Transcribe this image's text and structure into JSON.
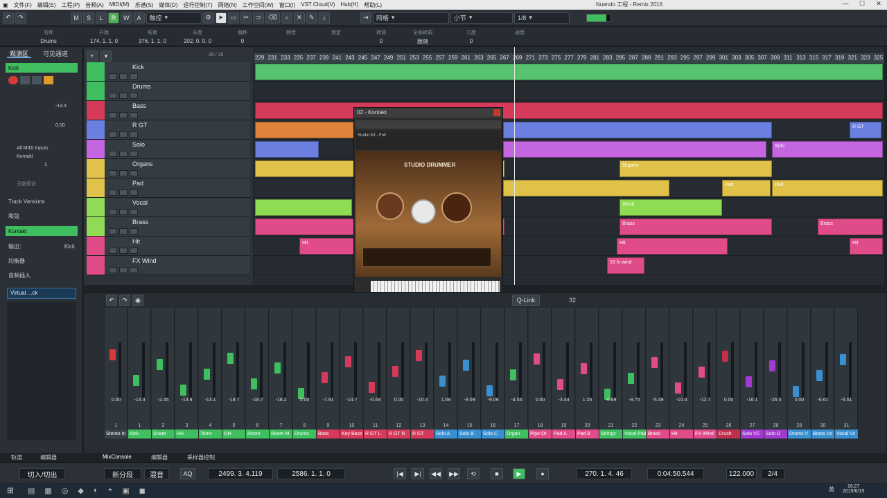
{
  "menu": [
    "文件(F)",
    "编辑(E)",
    "工程(P)",
    "音频(A)",
    "MIDI(M)",
    "乐谱(S)",
    "媒体(D)",
    "运行控制(T)",
    "网络(N)",
    "工作空间(W)",
    "窗口(I)",
    "VST Cloud(V)",
    "Hub(H)",
    "帮助(L)"
  ],
  "window_title": "Nuendo 工程 - Remix 2016",
  "toolbar": {
    "msl": [
      "M",
      "S",
      "L"
    ],
    "rwa": [
      "R",
      "W",
      "A"
    ],
    "mode": "触控",
    "grid": "网格",
    "snap_unit": "小节",
    "quantize": "1/8"
  },
  "infoline": {
    "headers": [
      "名称",
      "开始",
      "结束",
      "长度",
      "偏移",
      "静音",
      "锁定",
      "转调",
      "全局转调",
      "力度",
      "通音"
    ],
    "values": [
      "Drums",
      "174. 1. 1. 0",
      "376. 1. 1. 0",
      "202. 0. 0. 0",
      "0",
      "",
      "",
      "0",
      "跟随",
      "0",
      ""
    ]
  },
  "inspector": {
    "tabs": [
      "观测区",
      "可见通道"
    ],
    "track": "Kick",
    "volume": "-14.3",
    "pan": "0.00",
    "input": "All MIDI Inputs",
    "output": "Kontakt",
    "channel": "1",
    "nofx": "无数预设",
    "sections": [
      "Track Versions",
      "和弦",
      "Kontakt",
      "输出：",
      "均衡器",
      "音频插入"
    ],
    "output_value": "Kick",
    "insert": "Virtual ...ck"
  },
  "tracklist": {
    "count": "35 / 35",
    "tracks": [
      {
        "name": "Kick",
        "color": "#3fbf5f"
      },
      {
        "name": "Drums",
        "color": "#3fbf5f"
      },
      {
        "name": "Bass",
        "color": "#d63a5a"
      },
      {
        "name": "R GT",
        "color": "#6a7fe0"
      },
      {
        "name": "Solo",
        "color": "#c466e0"
      },
      {
        "name": "Organs",
        "color": "#e0c24a"
      },
      {
        "name": "Pad",
        "color": "#e0c24a"
      },
      {
        "name": "Vocal",
        "color": "#8fdc54"
      },
      {
        "name": "Brass",
        "color": "#8fdc54"
      },
      {
        "name": "Hit",
        "color": "#e04c8a"
      },
      {
        "name": "FX Wind",
        "color": "#e04c8a"
      }
    ]
  },
  "ruler": [
    "229",
    "231",
    "233",
    "235",
    "237",
    "239",
    "241",
    "243",
    "245",
    "247",
    "249",
    "251",
    "253",
    "255",
    "257",
    "259",
    "261",
    "263",
    "265",
    "267",
    "269",
    "271",
    "273",
    "275",
    "277",
    "279",
    "281",
    "283",
    "285",
    "287",
    "289",
    "291",
    "293",
    "295",
    "297",
    "299",
    "301",
    "303",
    "305",
    "307",
    "309",
    "311",
    "313",
    "315",
    "317",
    "319",
    "321",
    "323",
    "325"
  ],
  "clips": {
    "organs": "Organs",
    "vocal": "Vocal",
    "brass": "Brass",
    "hit": "Hit",
    "pad": "Pad",
    "solo": "Solo",
    "rgt": "R GT",
    "wind": "15 fx wind"
  },
  "kontakt": {
    "title": "02 - Kontakt",
    "product": "STUDIO DRUMMER",
    "preset": "Studio Kit - Full"
  },
  "mixer": {
    "qlink": "Q-Link",
    "num": "32",
    "channels": [
      {
        "n": "1",
        "l": "Stereo In",
        "c": "#3a4249",
        "v": "0.00"
      },
      {
        "n": "1",
        "l": "Kick",
        "c": "#3fbf5f",
        "v": "-14.3"
      },
      {
        "n": "2",
        "l": "Snare",
        "c": "#3fbf5f",
        "v": "-2.45"
      },
      {
        "n": "3",
        "l": "HH",
        "c": "#3fbf5f",
        "v": "-13.9"
      },
      {
        "n": "4",
        "l": "Toms",
        "c": "#3fbf5f",
        "v": "-13.1"
      },
      {
        "n": "5",
        "l": "OH",
        "c": "#3fbf5f",
        "v": "-18.7"
      },
      {
        "n": "6",
        "l": "Room",
        "c": "#3fbf5f",
        "v": "-18.7"
      },
      {
        "n": "7",
        "l": "Room M",
        "c": "#3fbf5f",
        "v": "-18.2"
      },
      {
        "n": "8",
        "l": "Drums",
        "c": "#3fbf5f",
        "v": "0.00"
      },
      {
        "n": "9",
        "l": "Bass",
        "c": "#d63a5a",
        "v": "-7.91"
      },
      {
        "n": "10",
        "l": "Key Bass",
        "c": "#d63a5a",
        "v": "-14.7"
      },
      {
        "n": "11",
        "l": "R GT L",
        "c": "#d63a5a",
        "v": "-0.64"
      },
      {
        "n": "12",
        "l": "R GT R",
        "c": "#d63a5a",
        "v": "0.00"
      },
      {
        "n": "13",
        "l": "R GT",
        "c": "#d63a5a",
        "v": "-10.4"
      },
      {
        "n": "14",
        "l": "Solo A",
        "c": "#3a8fd0",
        "v": "1.69"
      },
      {
        "n": "15",
        "l": "Solo B",
        "c": "#3a8fd0",
        "v": "-9.09"
      },
      {
        "n": "16",
        "l": "Solo C",
        "c": "#3a8fd0",
        "v": "-9.09"
      },
      {
        "n": "17",
        "l": "Organ",
        "c": "#3fbf5f",
        "v": "-4.55"
      },
      {
        "n": "18",
        "l": "Pipe Or",
        "c": "#e04c8a",
        "v": "0.00"
      },
      {
        "n": "19",
        "l": "Pad A",
        "c": "#e04c8a",
        "v": "-3.44"
      },
      {
        "n": "20",
        "l": "Pad B",
        "c": "#e04c8a",
        "v": "1.25"
      },
      {
        "n": "21",
        "l": "Strings",
        "c": "#3fbf5f",
        "v": "-6.69"
      },
      {
        "n": "22",
        "l": "Vocal Pad",
        "c": "#3fbf5f",
        "v": "-8.75"
      },
      {
        "n": "23",
        "l": "Brass",
        "c": "#e04c8a",
        "v": "-5.49"
      },
      {
        "n": "24",
        "l": "Hit",
        "c": "#e04c8a",
        "v": "-10.4"
      },
      {
        "n": "25",
        "l": "FX Wind",
        "c": "#e04c8a",
        "v": "-12.7"
      },
      {
        "n": "26",
        "l": "Crush",
        "c": "#c0304a",
        "v": "0.00"
      },
      {
        "n": "27",
        "l": "Solo VC",
        "c": "#a23ad0",
        "v": "-16.1"
      },
      {
        "n": "28",
        "l": "Solo D",
        "c": "#a23ad0",
        "v": "-26.5"
      },
      {
        "n": "29",
        "l": "Drums V",
        "c": "#3a8fd0",
        "v": "0.00"
      },
      {
        "n": "30",
        "l": "Brass Vc",
        "c": "#3a8fd0",
        "v": "-6.61"
      },
      {
        "n": "31",
        "l": "Vocal Vc",
        "c": "#3a8fd0",
        "v": "-6.61"
      }
    ]
  },
  "lowertabs": [
    "轨道",
    "编辑器",
    "MixConsole",
    "编辑器",
    "采样器控制"
  ],
  "transport": {
    "punch": "切入/切出",
    "segment": "新分段",
    "mix": "混音",
    "aq": "AQ",
    "left": "2499. 3. 4.119",
    "right": "2586. 1. 1. 0",
    "pos": "270. 1. 4. 46",
    "time": "0:04:50.544",
    "tempo": "122.000",
    "sig": "2/4"
  },
  "taskbar": {
    "time": "16:27",
    "date": "2019/6/19",
    "lang": "英"
  }
}
